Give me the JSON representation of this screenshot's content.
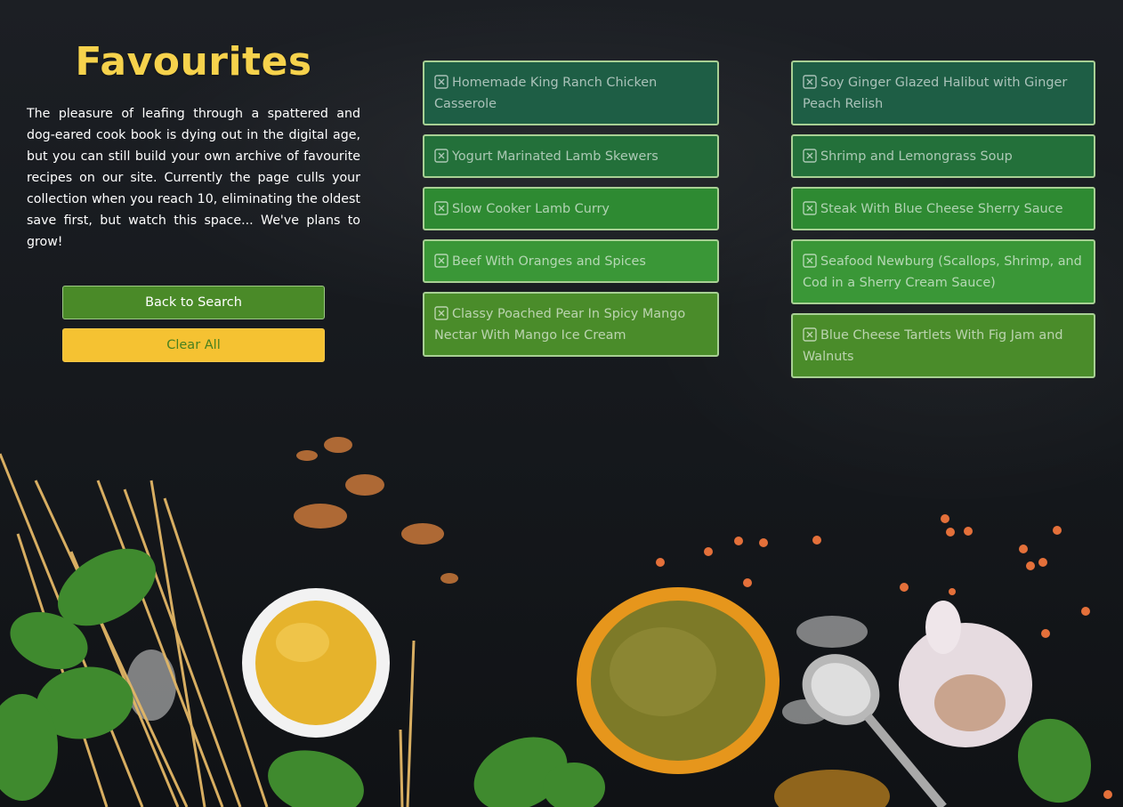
{
  "page": {
    "title": "Favourites",
    "description": "The pleasure of leafing through a spattered and dog-eared cook book is dying out in the digital age, but you can still build your own archive of favourite recipes on our site. Currently the page culls your collection when you reach 10, eliminating the oldest save first, but watch this space... We've plans to grow!"
  },
  "buttons": {
    "back_label": "Back to Search",
    "clear_label": "Clear All"
  },
  "favourites": {
    "left": [
      {
        "label": "Homemade King Ranch Chicken Casserole"
      },
      {
        "label": "Yogurt Marinated Lamb Skewers"
      },
      {
        "label": "Slow Cooker Lamb Curry"
      },
      {
        "label": "Beef With Oranges and Spices"
      },
      {
        "label": "Classy Poached Pear In Spicy Mango Nectar With Mango Ice Cream"
      }
    ],
    "right": [
      {
        "label": "Soy Ginger Glazed Halibut with Ginger Peach Relish"
      },
      {
        "label": "Shrimp and Lemongrass Soup"
      },
      {
        "label": "Steak With Blue Cheese Sherry Sauce"
      },
      {
        "label": "Seafood Newburg (Scallops, Shrimp, and Cod in a Sherry Cream Sauce)"
      },
      {
        "label": "Blue Cheese Tartlets With Fig Jam and Walnuts"
      }
    ]
  },
  "icons": {
    "remove": "close-box-icon"
  },
  "colors": {
    "title": "#f6d24c",
    "back_button": "#4a8a28",
    "clear_button": "#f5c232",
    "card_border": "#a8d094",
    "card_gradient": [
      "#1e5e45",
      "#23703a",
      "#2e8a32",
      "#3a9737",
      "#4a8c2a"
    ]
  }
}
